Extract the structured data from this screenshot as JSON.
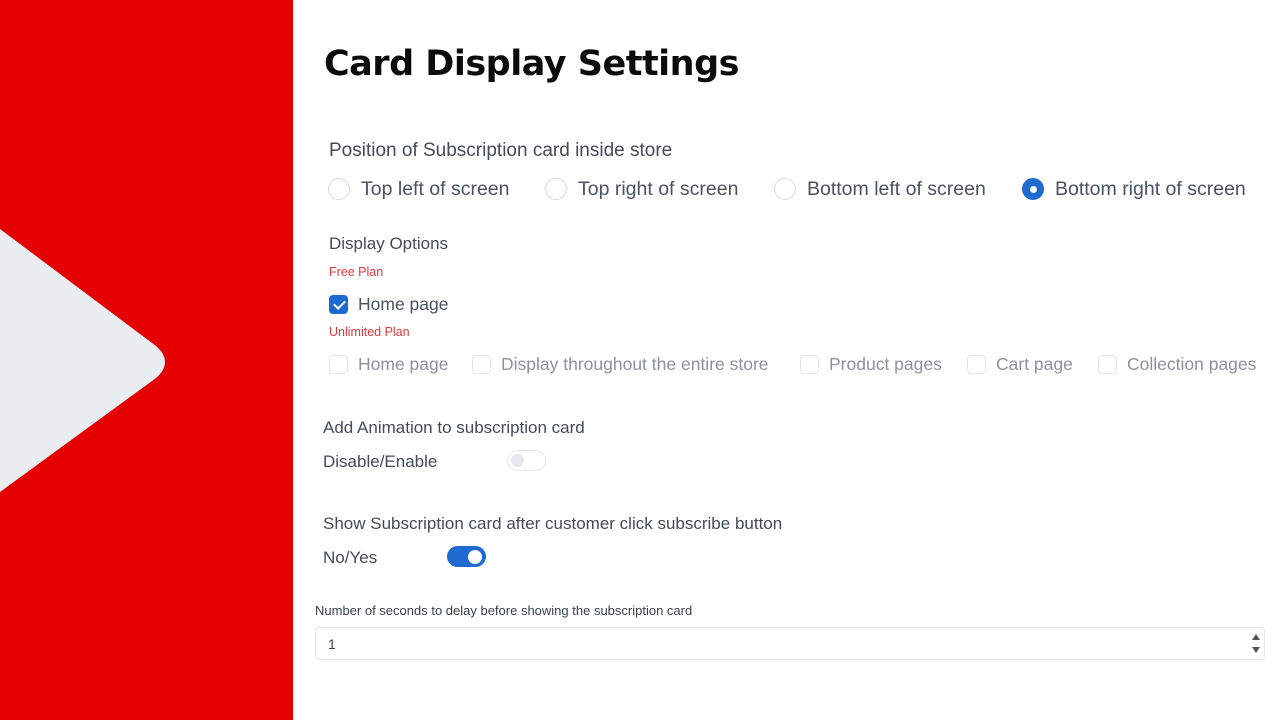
{
  "branding": {
    "panel_color": "#e50000",
    "play_shape_color": "#e9edf1",
    "icon": "play-triangle-icon"
  },
  "page": {
    "title": "Card Display Settings"
  },
  "position": {
    "label": "Position of Subscription card inside store",
    "options": [
      {
        "label": "Top left of screen",
        "selected": false
      },
      {
        "label": "Top right of screen",
        "selected": false
      },
      {
        "label": "Bottom left of screen",
        "selected": false
      },
      {
        "label": "Bottom right of screen",
        "selected": true
      }
    ]
  },
  "display_options": {
    "label": "Display Options",
    "free_plan": {
      "label": "Free Plan",
      "items": [
        {
          "label": "Home page",
          "checked": true,
          "enabled": true
        }
      ]
    },
    "unlimited_plan": {
      "label": "Unlimited Plan",
      "items": [
        {
          "label": "Home page",
          "checked": false,
          "enabled": false
        },
        {
          "label": "Display throughout the entire store",
          "checked": false,
          "enabled": false
        },
        {
          "label": "Product pages",
          "checked": false,
          "enabled": false
        },
        {
          "label": "Cart page",
          "checked": false,
          "enabled": false
        },
        {
          "label": "Collection pages",
          "checked": false,
          "enabled": false
        }
      ]
    }
  },
  "animation": {
    "label": "Add Animation to subscription card",
    "toggle_label": "Disable/Enable",
    "enabled": false
  },
  "show_after_click": {
    "label": "Show Subscription card after customer click subscribe button",
    "toggle_label": "No/Yes",
    "enabled": true
  },
  "delay": {
    "label": "Number of seconds to delay before showing the subscription card",
    "value": "1"
  },
  "colors": {
    "accent": "#1e6ad1",
    "plan_label": "#e0393b",
    "title": "#0b0b0b",
    "text": "#444b58"
  }
}
